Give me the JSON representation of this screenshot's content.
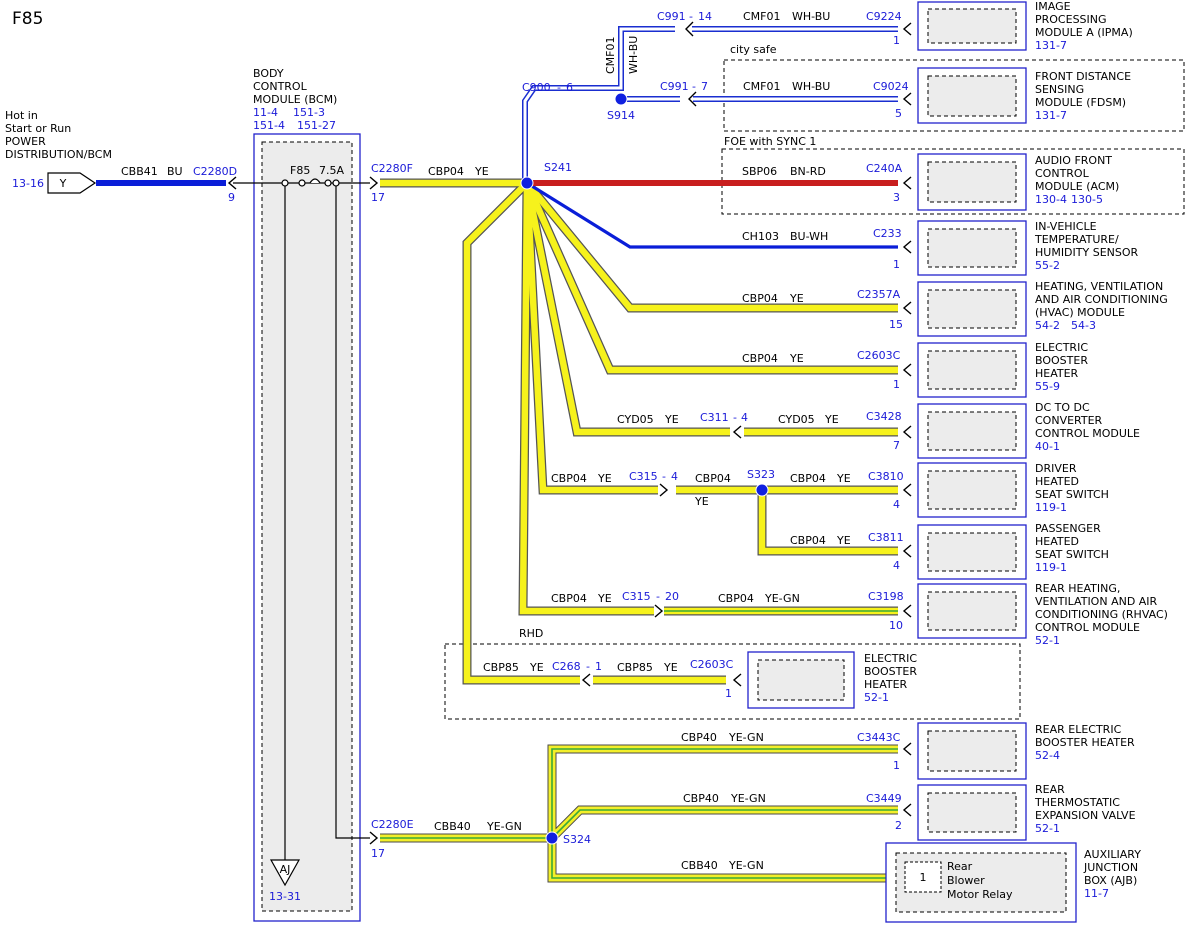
{
  "page_id": "F85",
  "source": {
    "lines": [
      "Hot in",
      "Start or Run",
      "POWER",
      "DISTRIBUTION/BCM"
    ],
    "ref": "13-16",
    "symbol": "Y"
  },
  "bcm": {
    "lines": [
      "BODY",
      "CONTROL",
      "MODULE (BCM)"
    ],
    "refs": [
      "11-4",
      "151-3",
      "151-4",
      "151-27"
    ],
    "fuse": "F85",
    "rating": "7.5A",
    "ground_symbol": "AJ",
    "ground_ref": "13-31"
  },
  "input_wire": {
    "circuit": "CBB41",
    "color": "BU",
    "connector": "C2280D",
    "pin": "9"
  },
  "out_f": {
    "connector": "C2280F",
    "pin": "17",
    "circuit": "CBP04",
    "color": "YE"
  },
  "out_e": {
    "connector": "C2280E",
    "pin": "17",
    "circuit": "CBB40",
    "color": "YE-GN"
  },
  "splices": {
    "s241": "S241",
    "s914": "S914",
    "s323": "S323",
    "s324": "S324"
  },
  "options": {
    "city_safe": "city safe",
    "foe_sync": "FOE with SYNC 1",
    "rhd": "RHD"
  },
  "shielded": {
    "c900": "C900",
    "c900_pin": "6",
    "vert_circuit": "CMF01",
    "vert_color": "WH-BU"
  },
  "modules": {
    "ipma": {
      "lines": [
        "IMAGE",
        "PROCESSING",
        "MODULE A (IPMA)"
      ],
      "refs": [
        "131-7"
      ],
      "connector": "C9224",
      "pin": "1",
      "circuit": "CMF01",
      "color": "WH-BU",
      "inline": "C991",
      "inline_pin": "14"
    },
    "fdsm": {
      "lines": [
        "FRONT DISTANCE",
        "SENSING",
        "MODULE (FDSM)"
      ],
      "refs": [
        "131-7"
      ],
      "connector": "C9024",
      "pin": "5",
      "circuit": "CMF01",
      "color": "WH-BU",
      "inline": "C991",
      "inline_pin": "7"
    },
    "acm": {
      "lines": [
        "AUDIO FRONT",
        "CONTROL",
        "MODULE (ACM)"
      ],
      "refs": [
        "130-4",
        "130-5"
      ],
      "connector": "C240A",
      "pin": "3",
      "circuit": "SBP06",
      "color": "BN-RD"
    },
    "temp": {
      "lines": [
        "IN-VEHICLE",
        "TEMPERATURE/",
        "HUMIDITY SENSOR"
      ],
      "refs": [
        "55-2"
      ],
      "connector": "C233",
      "pin": "1",
      "circuit": "CH103",
      "color": "BU-WH"
    },
    "hvac": {
      "lines": [
        "HEATING, VENTILATION",
        "AND AIR CONDITIONING",
        "(HVAC) MODULE"
      ],
      "refs": [
        "54-2",
        "54-3"
      ],
      "connector": "C2357A",
      "pin": "15",
      "circuit": "CBP04",
      "color": "YE"
    },
    "ebh": {
      "lines": [
        "ELECTRIC",
        "BOOSTER",
        "HEATER"
      ],
      "refs": [
        "55-9"
      ],
      "connector": "C2603C",
      "pin": "1",
      "circuit": "CBP04",
      "color": "YE"
    },
    "dcdc": {
      "lines": [
        "DC TO DC",
        "CONVERTER",
        "CONTROL MODULE"
      ],
      "refs": [
        "40-1"
      ],
      "connector": "C3428",
      "pin": "7",
      "circuit": "CYD05",
      "color": "YE",
      "inline": "C311",
      "inline_pin": "4",
      "left_circuit": "CYD05",
      "left_color": "YE"
    },
    "dhss": {
      "lines": [
        "DRIVER",
        "HEATED",
        "SEAT SWITCH"
      ],
      "refs": [
        "119-1"
      ],
      "connector": "C3810",
      "pin": "4",
      "circuit": "CBP04",
      "color": "YE",
      "inline": "C315",
      "inline_pin": "4",
      "left_circuit": "CBP04",
      "left_color": "YE",
      "mid_circuit": "CBP04",
      "mid_color": "YE"
    },
    "phss": {
      "lines": [
        "PASSENGER",
        "HEATED",
        "SEAT SWITCH"
      ],
      "refs": [
        "119-1"
      ],
      "connector": "C3811",
      "pin": "4",
      "circuit": "CBP04",
      "color": "YE"
    },
    "rhvac": {
      "lines": [
        "REAR HEATING,",
        "VENTILATION AND AIR",
        "CONDITIONING (RHVAC)",
        "CONTROL MODULE"
      ],
      "refs": [
        "52-1"
      ],
      "connector": "C3198",
      "pin": "10",
      "circuit": "CBP04",
      "color": "YE-GN",
      "inline": "C315",
      "inline_pin": "20",
      "left_circuit": "CBP04",
      "left_color": "YE"
    },
    "ebh_rhd": {
      "lines": [
        "ELECTRIC",
        "BOOSTER",
        "HEATER"
      ],
      "refs": [
        "52-1"
      ],
      "connector": "C2603C",
      "pin": "1",
      "circuit": "CBP85",
      "color": "YE",
      "inline": "C268",
      "inline_pin": "1",
      "left_circuit": "CBP85",
      "left_color": "YE"
    },
    "rebh": {
      "lines": [
        "REAR ELECTRIC",
        "BOOSTER HEATER"
      ],
      "refs": [
        "52-4"
      ],
      "connector": "C3443C",
      "pin": "1",
      "circuit": "CBP40",
      "color": "YE-GN"
    },
    "rtxv": {
      "lines": [
        "REAR",
        "THERMOSTATIC",
        "EXPANSION VALVE"
      ],
      "refs": [
        "52-1"
      ],
      "connector": "C3449",
      "pin": "2",
      "circuit": "CBP40",
      "color": "YE-GN"
    },
    "ajb": {
      "lines": [
        "AUXILIARY",
        "JUNCTION",
        "BOX (AJB)"
      ],
      "refs": [
        "11-7"
      ],
      "circuit": "CBB40",
      "color": "YE-GN",
      "inner_pin": "1",
      "inner_lines": [
        "Rear",
        "Blower",
        "Motor Relay"
      ]
    }
  }
}
